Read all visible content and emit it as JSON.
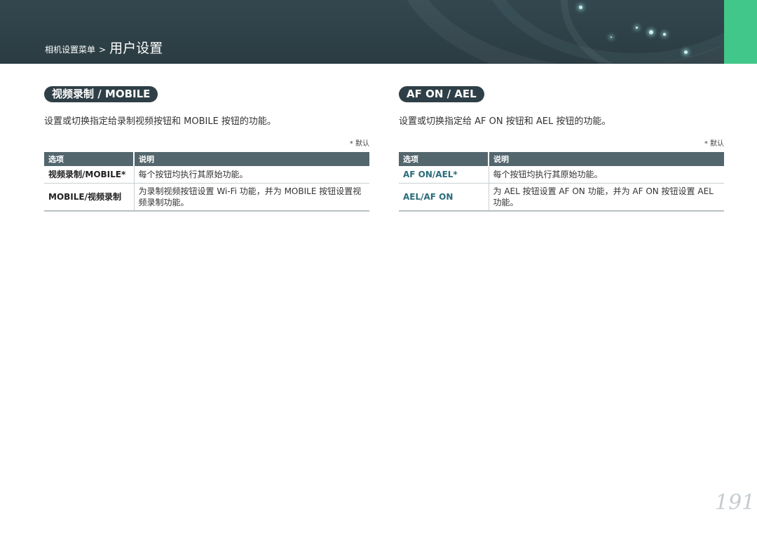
{
  "header": {
    "breadcrumb_parent": "相机设置菜单",
    "breadcrumb_sep": ">",
    "breadcrumb_current": "用户设置",
    "accent_color": "#41c78a"
  },
  "left": {
    "title": "视频录制 / MOBILE",
    "description": "设置或切换指定给录制视频按钮和 MOBILE 按钮的功能。",
    "default_note": "* 默认",
    "col_option": "选项",
    "col_desc": "说明",
    "rows": [
      {
        "option": "视频录制/MOBILE*",
        "desc": "每个按钮均执行其原始功能。"
      },
      {
        "option": "MOBILE/视频录制",
        "desc": "为录制视频按钮设置 Wi-Fi 功能，并为 MOBILE 按钮设置视频录制功能。"
      }
    ]
  },
  "right": {
    "title": "AF ON / AEL",
    "description": "设置或切换指定给 AF ON 按钮和 AEL 按钮的功能。",
    "default_note": "* 默认",
    "col_option": "选项",
    "col_desc": "说明",
    "rows": [
      {
        "option": "AF ON/AEL*",
        "desc": "每个按钮均执行其原始功能。"
      },
      {
        "option": "AEL/AF ON",
        "desc": "为 AEL 按钮设置 AF ON 功能，并为 AF ON 按钮设置 AEL 功能。"
      }
    ]
  },
  "page_number": "191"
}
